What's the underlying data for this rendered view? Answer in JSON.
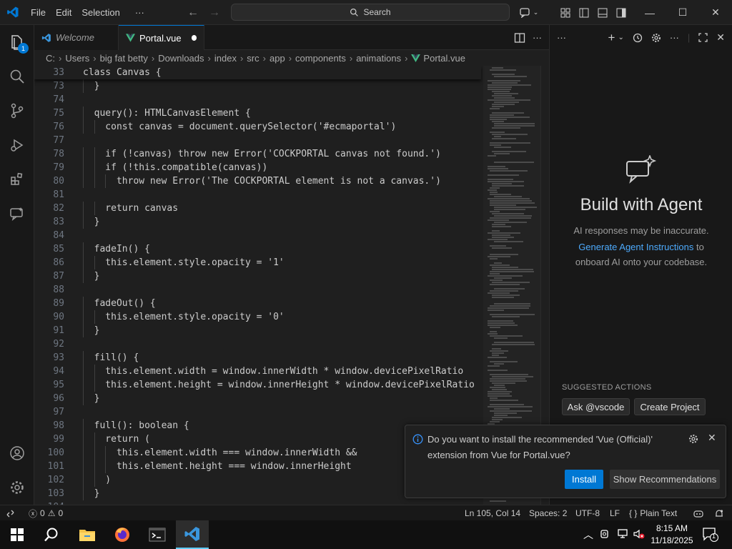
{
  "titlebar": {
    "menu": [
      "File",
      "Edit",
      "Selection",
      "···"
    ],
    "search_label": "Search"
  },
  "activitybar": {
    "explorer_badge": "1"
  },
  "tabs": [
    {
      "label": "Welcome",
      "active": false
    },
    {
      "label": "Portal.vue",
      "active": true,
      "modified": true
    }
  ],
  "breadcrumb": [
    "C:",
    "Users",
    "big fat betty",
    "Downloads",
    "index",
    "src",
    "app",
    "components",
    "animations",
    "Portal.vue"
  ],
  "editor": {
    "sticky": {
      "line": "33",
      "code": "class Canvas {"
    },
    "lines": [
      {
        "n": "73",
        "code": "  }"
      },
      {
        "n": "74",
        "code": ""
      },
      {
        "n": "75",
        "code": "  query(): HTMLCanvasElement {"
      },
      {
        "n": "76",
        "code": "    const canvas = document.querySelector('#ecmaportal')"
      },
      {
        "n": "77",
        "code": ""
      },
      {
        "n": "78",
        "code": "    if (!canvas) throw new Error('COCKPORTAL canvas not found.')"
      },
      {
        "n": "79",
        "code": "    if (!this.compatible(canvas))"
      },
      {
        "n": "80",
        "code": "      throw new Error('The COCKPORTAL element is not a canvas.')"
      },
      {
        "n": "81",
        "code": ""
      },
      {
        "n": "82",
        "code": "    return canvas"
      },
      {
        "n": "83",
        "code": "  }"
      },
      {
        "n": "84",
        "code": ""
      },
      {
        "n": "85",
        "code": "  fadeIn() {"
      },
      {
        "n": "86",
        "code": "    this.element.style.opacity = '1'"
      },
      {
        "n": "87",
        "code": "  }"
      },
      {
        "n": "88",
        "code": ""
      },
      {
        "n": "89",
        "code": "  fadeOut() {"
      },
      {
        "n": "90",
        "code": "    this.element.style.opacity = '0'"
      },
      {
        "n": "91",
        "code": "  }"
      },
      {
        "n": "92",
        "code": ""
      },
      {
        "n": "93",
        "code": "  fill() {"
      },
      {
        "n": "94",
        "code": "    this.element.width = window.innerWidth * window.devicePixelRatio"
      },
      {
        "n": "95",
        "code": "    this.element.height = window.innerHeight * window.devicePixelRatio"
      },
      {
        "n": "96",
        "code": "  }"
      },
      {
        "n": "97",
        "code": ""
      },
      {
        "n": "98",
        "code": "  full(): boolean {"
      },
      {
        "n": "99",
        "code": "    return ("
      },
      {
        "n": "100",
        "code": "      this.element.width === window.innerWidth &&"
      },
      {
        "n": "101",
        "code": "      this.element.height === window.innerHeight"
      },
      {
        "n": "102",
        "code": "    )"
      },
      {
        "n": "103",
        "code": "  }"
      },
      {
        "n": "104",
        "code": ""
      }
    ]
  },
  "agent_panel": {
    "title": "Build with Agent",
    "disclaimer": "AI responses may be inaccurate.",
    "link": "Generate Agent Instructions",
    "after_link": " to onboard AI onto your codebase.",
    "suggested_label": "SUGGESTED ACTIONS",
    "actions": [
      "Ask @vscode",
      "Create Project"
    ]
  },
  "notification": {
    "message": "Do you want to install the recommended 'Vue (Official)' extension from Vue for Portal.vue?",
    "primary": "Install",
    "secondary": "Show Recommendations"
  },
  "statusbar": {
    "errors": "0",
    "warnings": "0",
    "position": "Ln 105, Col 14",
    "spaces": "Spaces: 2",
    "encoding": "UTF-8",
    "eol": "LF",
    "language": "Plain Text"
  },
  "taskbar": {
    "time": "8:15 AM",
    "date": "11/18/2025",
    "notification_count": "1"
  },
  "colors": {
    "accent": "#0078d4",
    "link": "#4daafc",
    "background": "#1f1f1f"
  }
}
